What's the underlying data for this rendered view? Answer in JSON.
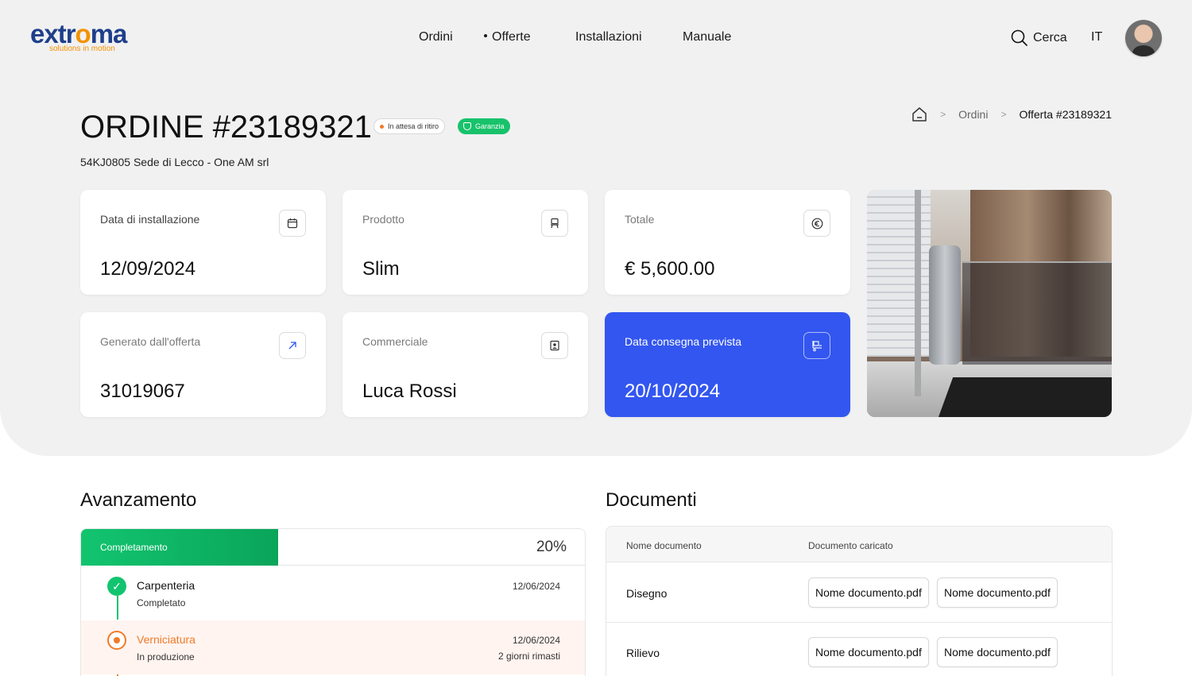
{
  "brand": {
    "logo_prefix": "extr",
    "logo_o": "o",
    "logo_suffix": "ma",
    "tagline": "solutions in motion",
    "primary_color": "#1e3f8a",
    "accent_color": "#f39200"
  },
  "nav": {
    "items": [
      {
        "label": "Ordini"
      },
      {
        "label": "Offerte",
        "marked": true
      },
      {
        "label": "Installazioni"
      },
      {
        "label": "Manuale"
      }
    ],
    "search_label": "Cerca",
    "language": "IT"
  },
  "header": {
    "title": "ORDINE #23189321",
    "badges": {
      "pending": "In attesa di ritiro",
      "warranty": "Garanzia"
    },
    "subtitle": "54KJ0805 Sede di Lecco - One AM srl",
    "breadcrumb": {
      "orders": "Ordini",
      "current": "Offerta #23189321"
    }
  },
  "cards": {
    "installation": {
      "label": "Data di installazione",
      "value": "12/09/2024",
      "icon": "calendar-icon"
    },
    "product": {
      "label": "Prodotto",
      "value": "Slim",
      "icon": "stairlift-icon"
    },
    "total": {
      "label": "Totale",
      "value": "€ 5,600.00",
      "icon": "euro-icon"
    },
    "offer": {
      "label": "Generato dall'offerta",
      "value": "31019067",
      "icon": "arrow-up-right-icon"
    },
    "sales": {
      "label": "Commerciale",
      "value": "Luca Rossi",
      "icon": "contact-card-icon"
    },
    "delivery": {
      "label": "Data consegna prevista",
      "value": "20/10/2024",
      "icon": "delivery-icon",
      "color": "#3356f0"
    }
  },
  "progress": {
    "title": "Avanzamento",
    "bar_label": "Completamento",
    "percent_text": "20%",
    "percent": 0.2,
    "steps": [
      {
        "name": "Carpenteria",
        "status": "Completato",
        "date": "12/06/2024",
        "remaining": "",
        "state": "done"
      },
      {
        "name": "Verniciatura",
        "status": "In produzione",
        "date": "12/06/2024",
        "remaining": "2 giorni rimasti",
        "state": "active"
      }
    ]
  },
  "documents": {
    "title": "Documenti",
    "columns": {
      "name": "Nome documento",
      "uploaded": "Documento caricato"
    },
    "rows": [
      {
        "name": "Disegno",
        "files": [
          "Nome documento.pdf",
          "Nome documento.pdf"
        ]
      },
      {
        "name": "Rilievo",
        "files": [
          "Nome documento.pdf",
          "Nome documento.pdf"
        ]
      }
    ]
  }
}
